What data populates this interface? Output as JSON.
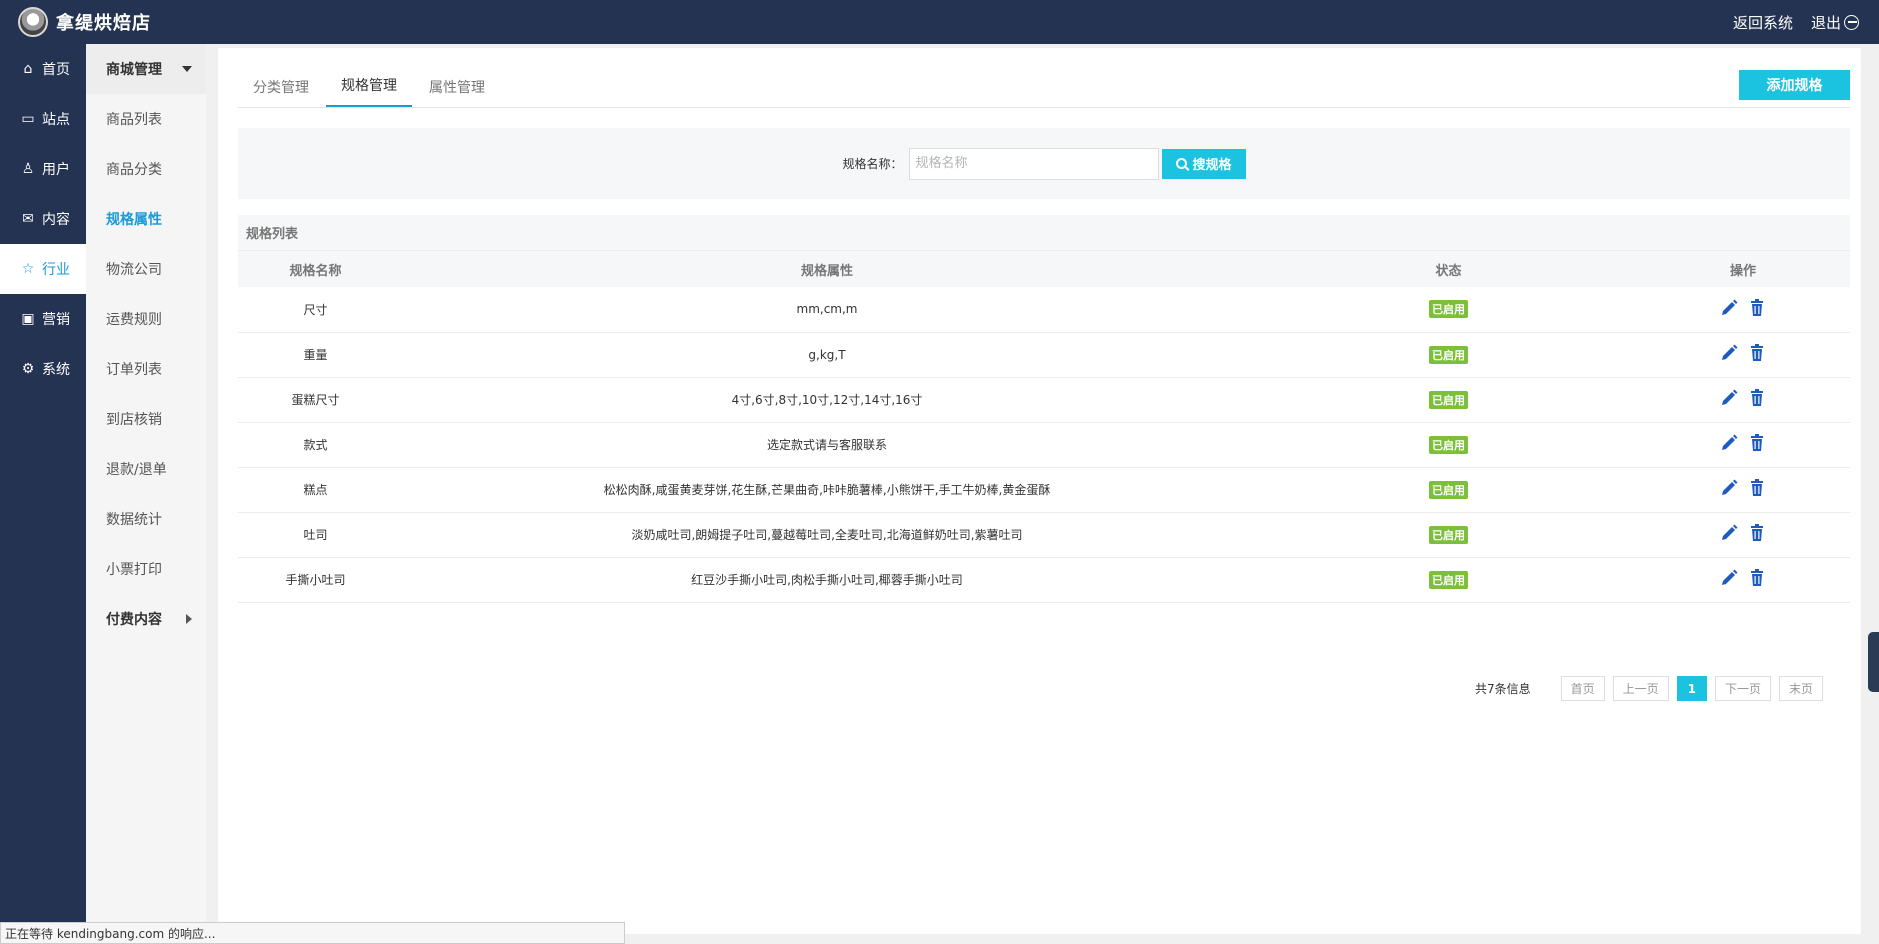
{
  "app": {
    "name": "拿缇烘焙店"
  },
  "topbar": {
    "back_label": "返回系统",
    "logout_label": "退出"
  },
  "mainnav": [
    {
      "label": "首页",
      "icon": "home-icon",
      "glyph": "⌂"
    },
    {
      "label": "站点",
      "icon": "monitor-icon",
      "glyph": "▭"
    },
    {
      "label": "用户",
      "icon": "user-icon",
      "glyph": "♙"
    },
    {
      "label": "内容",
      "icon": "inbox-icon",
      "glyph": "✉"
    },
    {
      "label": "行业",
      "icon": "star-icon",
      "glyph": "☆",
      "active": true
    },
    {
      "label": "营销",
      "icon": "wallet-icon",
      "glyph": "▣"
    },
    {
      "label": "系统",
      "icon": "gear-icon",
      "glyph": "⚙"
    }
  ],
  "subnav": {
    "header": "商城管理",
    "items": [
      "商品列表",
      "商品分类",
      "规格属性",
      "物流公司",
      "运费规则",
      "订单列表",
      "到店核销",
      "退款/退单",
      "数据统计",
      "小票打印"
    ],
    "active_index": 2,
    "footer": "付费内容"
  },
  "tabs": [
    "分类管理",
    "规格管理",
    "属性管理"
  ],
  "active_tab": 1,
  "add_button": "添加规格",
  "search": {
    "label": "规格名称：",
    "placeholder": "规格名称",
    "button": "搜规格"
  },
  "list": {
    "title": "规格列表",
    "columns": [
      "规格名称",
      "规格属性",
      "状态",
      "操作"
    ],
    "rows": [
      {
        "name": "尺寸",
        "attrs": "mm,cm,m",
        "status": "已启用"
      },
      {
        "name": "重量",
        "attrs": "g,kg,T",
        "status": "已启用"
      },
      {
        "name": "蛋糕尺寸",
        "attrs": "4寸,6寸,8寸,10寸,12寸,14寸,16寸",
        "status": "已启用"
      },
      {
        "name": "款式",
        "attrs": "选定款式请与客服联系",
        "status": "已启用"
      },
      {
        "name": "糕点",
        "attrs": "松松肉酥,咸蛋黄麦芽饼,花生酥,芒果曲奇,咔咔脆薯棒,小熊饼干,手工牛奶棒,黄金蛋酥",
        "status": "已启用"
      },
      {
        "name": "吐司",
        "attrs": "淡奶咸吐司,朗姆提子吐司,蔓越莓吐司,全麦吐司,北海道鲜奶吐司,紫薯吐司",
        "status": "已启用"
      },
      {
        "name": "手撕小吐司",
        "attrs": "红豆沙手撕小吐司,肉松手撕小吐司,椰蓉手撕小吐司",
        "status": "已启用"
      }
    ]
  },
  "pagination": {
    "info": "共7条信息",
    "first": "首页",
    "prev": "上一页",
    "current": "1",
    "next": "下一页",
    "last": "末页"
  },
  "statusbar": "正在等待 kendingbang.com 的响应...",
  "colors": {
    "nav_bg": "#243352",
    "accent": "#1bc3e1",
    "link_active": "#1a9ad7",
    "badge_green": "#7bbf3a",
    "icon_blue": "#1e5bbf"
  }
}
